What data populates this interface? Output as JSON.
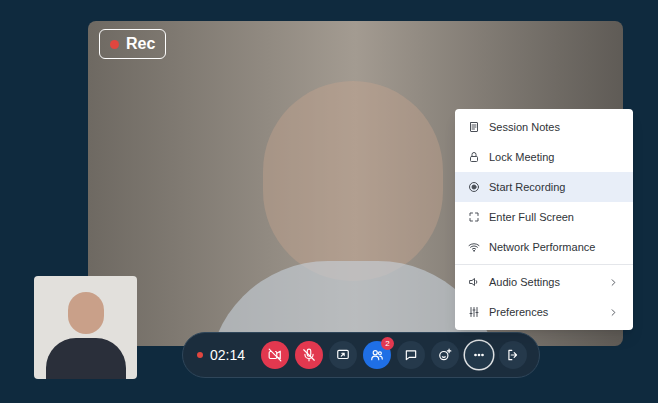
{
  "recording_badge": {
    "label": "Rec",
    "recording": true
  },
  "toolbar": {
    "recording": true,
    "timer": "02:14",
    "buttons": [
      {
        "kind": "camera",
        "off": true,
        "active": false
      },
      {
        "kind": "mic",
        "off": true,
        "active": false
      },
      {
        "kind": "share",
        "off": false,
        "active": false
      },
      {
        "kind": "participants",
        "off": false,
        "active": true,
        "badge": "2"
      },
      {
        "kind": "chat",
        "off": false,
        "active": false
      },
      {
        "kind": "reactions",
        "off": false,
        "active": false
      },
      {
        "kind": "more",
        "off": false,
        "active": true
      },
      {
        "kind": "leave",
        "off": false,
        "active": false
      }
    ]
  },
  "menu": {
    "open": true,
    "sections": [
      {
        "items": [
          {
            "label": "Session Notes",
            "selected": false,
            "submenu": false
          },
          {
            "label": "Lock Meeting",
            "selected": false,
            "submenu": false
          },
          {
            "label": "Start Recording",
            "selected": true,
            "submenu": false
          },
          {
            "label": "Enter Full Screen",
            "selected": false,
            "submenu": false
          },
          {
            "label": "Network Performance",
            "selected": false,
            "submenu": false
          }
        ]
      },
      {
        "items": [
          {
            "label": "Audio Settings",
            "selected": false,
            "submenu": true
          },
          {
            "label": "Preferences",
            "selected": false,
            "submenu": true
          }
        ]
      }
    ]
  }
}
